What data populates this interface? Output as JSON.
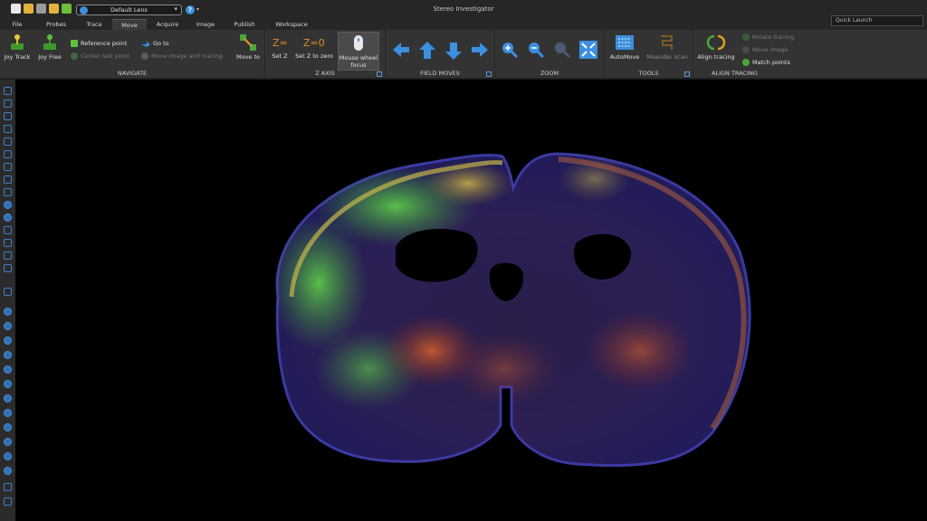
{
  "window": {
    "title": "Stereo Investigator"
  },
  "lens": {
    "value": "Default Lens"
  },
  "quick_launch": {
    "placeholder": "Quick Launch"
  },
  "tabs": [
    {
      "label": "File",
      "active": false
    },
    {
      "label": "Probes",
      "active": false
    },
    {
      "label": "Trace",
      "active": false
    },
    {
      "label": "Move",
      "active": true
    },
    {
      "label": "Acquire",
      "active": false
    },
    {
      "label": "Image",
      "active": false
    },
    {
      "label": "Publish",
      "active": false
    },
    {
      "label": "Workspace",
      "active": false
    }
  ],
  "ribbon": {
    "navigate": {
      "label": "NAVIGATE",
      "joy_track": "Joy Track",
      "joy_free": "Joy Free",
      "reference_point": "Reference point",
      "center_last_point": "Center last point",
      "go_to": "Go to",
      "move_image_tracing": "Move image and tracing",
      "move_to": "Move to"
    },
    "z_axis": {
      "label": "Z AXIS",
      "set_z": "Set Z",
      "set_z_zero": "Set Z to zero",
      "mouse_wheel_focus": "Mouse wheel focus"
    },
    "field_moves": {
      "label": "FIELD MOVES"
    },
    "zoom": {
      "label": "ZOOM"
    },
    "tools": {
      "label": "TOOLS",
      "automove": "AutoMove",
      "meander_scan": "Meander scan"
    },
    "align_tracing": {
      "label": "ALIGN TRACING",
      "align_tracing": "Align tracing",
      "rotate_tracing": "Rotate tracing",
      "move_image": "Move image",
      "match_points": "Match points"
    }
  },
  "colors": {
    "accent": "#3d8fe0",
    "ribbon_bg": "#333333",
    "canvas_bg": "#000000"
  }
}
